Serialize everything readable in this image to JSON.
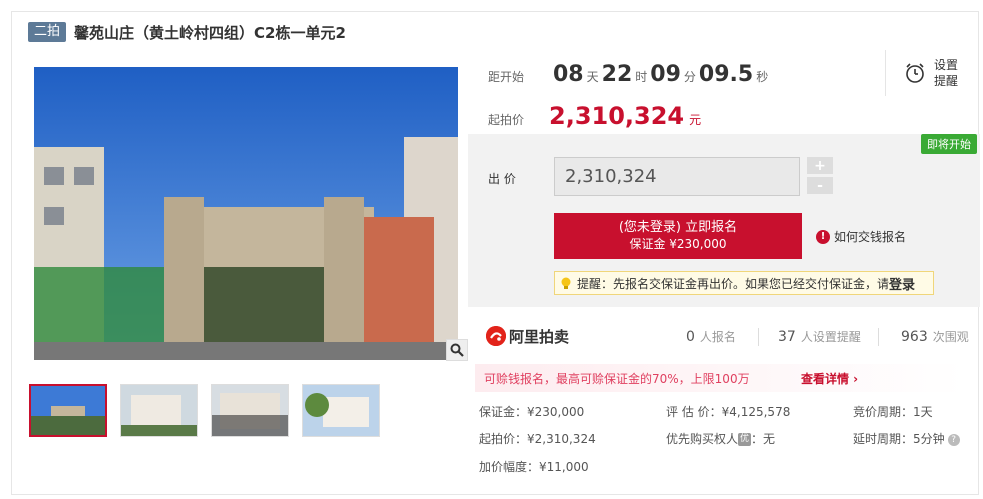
{
  "header": {
    "badge": "二拍",
    "title": "馨苑山庄（黄土岭村四组）C2栋一单元2"
  },
  "countdown": {
    "label": "距开始",
    "days": "08",
    "days_unit": "天",
    "hours": "22",
    "hours_unit": "时",
    "minutes": "09",
    "minutes_unit": "分",
    "seconds": "09.5",
    "seconds_unit": "秒"
  },
  "reminder": {
    "label_line1": "设置",
    "label_line2": "提醒",
    "icon": "alarm-clock-icon"
  },
  "start_price": {
    "label": "起拍价",
    "value": "2,310,324",
    "unit": "元"
  },
  "bid": {
    "status_tag": "即将开始",
    "label": "出 价",
    "value": "2,310,324",
    "plus": "+",
    "minus": "-",
    "register_line1": "(您未登录) 立即报名",
    "register_line2": "保证金 ¥230,000",
    "how_pay": "如何交钱报名",
    "hint": "提醒：先报名交保证金再出价。如果您已经交付保证金，请",
    "hint_login": "登录"
  },
  "stats": {
    "logo_text": "阿里拍卖",
    "signups": "0",
    "signups_unit": "人报名",
    "reminders": "37",
    "reminders_unit": "人设置提醒",
    "views": "963",
    "views_unit": "次围观"
  },
  "promo": {
    "text": "可赊钱报名，最高可赊保证金的70%，上限100万",
    "link": "查看详情 ›"
  },
  "details": {
    "deposit": "保证金：¥230,000",
    "appraisal": "评 估 价：¥4,125,578",
    "cycle": "竞价周期：1天",
    "start": "起拍价：¥2,310,324",
    "priority_label": "优先购买权人",
    "priority_icon": "优",
    "priority_value": "：无",
    "delay": "延时周期：5分钟",
    "increment": "加价幅度：¥11,000"
  },
  "colors": {
    "accent": "#c8102e",
    "badge": "#5d7a97",
    "tag_green": "#3aaa35"
  }
}
